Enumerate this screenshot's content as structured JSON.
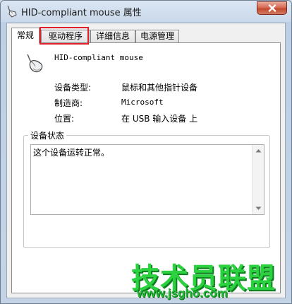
{
  "window": {
    "title": "HID-compliant mouse 属性",
    "close_label": "x"
  },
  "tabs": [
    {
      "label": "常规",
      "active": true
    },
    {
      "label": "驱动程序",
      "active": false,
      "highlighted": true
    },
    {
      "label": "详细信息",
      "active": false
    },
    {
      "label": "电源管理",
      "active": false
    }
  ],
  "general": {
    "device_name": "HID-compliant mouse",
    "props": [
      {
        "label": "设备类型:",
        "value": "鼠标和其他指针设备"
      },
      {
        "label": "制造商:",
        "value": "Microsoft"
      },
      {
        "label": "位置:",
        "value": "在 USB 输入设备 上"
      }
    ],
    "status_group_title": "设备状态",
    "status_text": "这个设备运转正常。"
  },
  "watermark": {
    "main": "技术员联盟",
    "url": "www.jsgho.com"
  },
  "colors": {
    "accent_red": "#e0202a",
    "watermark_green": "#2bd13f"
  },
  "icons": {
    "title": "mouse-icon",
    "device": "mouse-icon",
    "close": "close-icon"
  }
}
